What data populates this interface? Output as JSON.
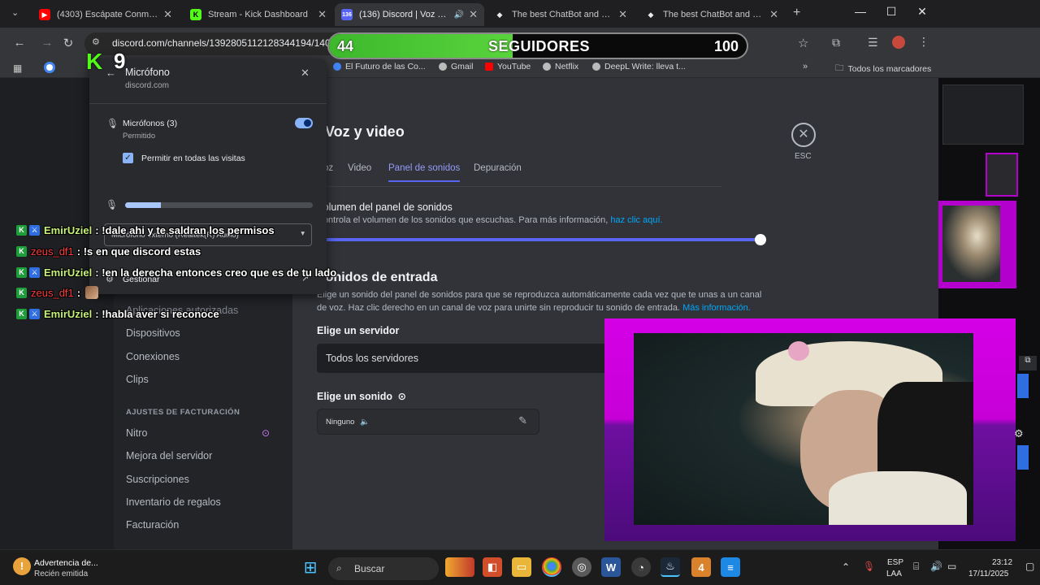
{
  "browser": {
    "tabs": [
      {
        "title": "(4303) Escápate Conmigo Re",
        "icon": "youtube-icon",
        "color": "#ff0000",
        "glyph": "▶"
      },
      {
        "title": "Stream - Kick Dashboard",
        "icon": "kick-icon",
        "color": "#53fc18",
        "glyph": "K"
      },
      {
        "title": "(136) Discord | Voz y vide",
        "icon": "discord-icon",
        "color": "#5865f2",
        "glyph": "136"
      },
      {
        "title": "The best ChatBot and Widge",
        "icon": "botrix-icon",
        "color": "#e8eaed",
        "glyph": "◆"
      },
      {
        "title": "The best ChatBot and Widge",
        "icon": "botrix-icon",
        "color": "#e8eaed",
        "glyph": "◆"
      }
    ],
    "url": "discord.com/channels/1392805112128344194/1402",
    "bookmarks": [
      {
        "label": "El Futuro de las Co...",
        "color": "#4285f4"
      },
      {
        "label": "Gmail",
        "color": "#bbbbbb"
      },
      {
        "label": "YouTube",
        "color": "#ff0000"
      },
      {
        "label": "Netflix",
        "color": "#bbbbbb"
      },
      {
        "label": "DeepL Write: lleva t...",
        "color": "#bbbbbb"
      }
    ],
    "all_bookmarks": "Todos los marcadores"
  },
  "followers_goal": {
    "current": "44",
    "label": "SEGUIDORES",
    "target": "100",
    "progress": 0.44
  },
  "kick_logo": {
    "letter": "K",
    "count": "9"
  },
  "permission_popup": {
    "title": "Micrófono",
    "site": "discord.com",
    "mic_label": "Micrófonos (3)",
    "mic_status": "Permitido",
    "allow_all": "Permitir en todas las visitas",
    "device": "Micrófono externo (Realtek(R) Audio)",
    "manage": "Gestionar",
    "level": 0.19
  },
  "discord": {
    "page_title": "Voz y video",
    "esc": "ESC",
    "tabs": [
      "Voz",
      "Video",
      "Panel de sonidos",
      "Depuración"
    ],
    "selected_tab": "Panel de sonidos",
    "soundboard_volume_title": "Volumen del panel de sonidos",
    "soundboard_volume_desc": "Controla el volumen de los sonidos que escuchas. Para más información,",
    "link_here": "haz clic aquí.",
    "volume": 1.0,
    "entry_title": "Sonidos de entrada",
    "entry_desc_1": "Elige un sonido del panel de sonidos para que se reproduzca automáticamente cada vez que te unas a un canal",
    "entry_desc_2": "de voz. Haz clic derecho en un canal de voz para unirte sin reproducir tu sonido de entrada.",
    "more_info": "Más información.",
    "server_label": "Elige un servidor",
    "server_value": "Todos los servidores",
    "sound_label": "Elige un sonido",
    "sound_value": "Ninguno",
    "sidebar": {
      "authorized_apps": "Aplicaciones autorizadas",
      "items": [
        "Dispositivos",
        "Conexiones",
        "Clips"
      ],
      "billing_header": "AJUSTES DE FACTURACIÓN",
      "billing_items": [
        "Nitro",
        "Mejora del servidor",
        "Suscripciones",
        "Inventario de regalos",
        "Facturación"
      ]
    }
  },
  "chat": [
    {
      "user": "EmirUziel",
      "color": "#c7f27a",
      "message": ": !dale ahi y te saldran los permisos",
      "badges": true
    },
    {
      "user": "zeus_df1",
      "color": "#ff3b3b",
      "message": ": !s en que discord estas",
      "badges": false
    },
    {
      "user": "EmirUziel",
      "color": "#c7f27a",
      "message": ": !en la derecha entonces creo que es de tu lado",
      "badges": true
    },
    {
      "user": "zeus_df1",
      "color": "#ff3b3b",
      "message": ":",
      "badges": false
    },
    {
      "user": "EmirUziel",
      "color": "#c7f27a",
      "message": ": !habla aver si reconoce",
      "badges": true
    }
  ],
  "taskbar": {
    "notification_title": "Advertencia de...",
    "notification_sub": "Recién emitida",
    "search": "Buscar",
    "lang_1": "ESP",
    "lang_2": "LAA",
    "time": "23:12",
    "date": "17/11/2025"
  },
  "colors": {
    "accent": "#5865f2",
    "kick_green": "#53fc18",
    "cam_frame": "#d400e6"
  }
}
